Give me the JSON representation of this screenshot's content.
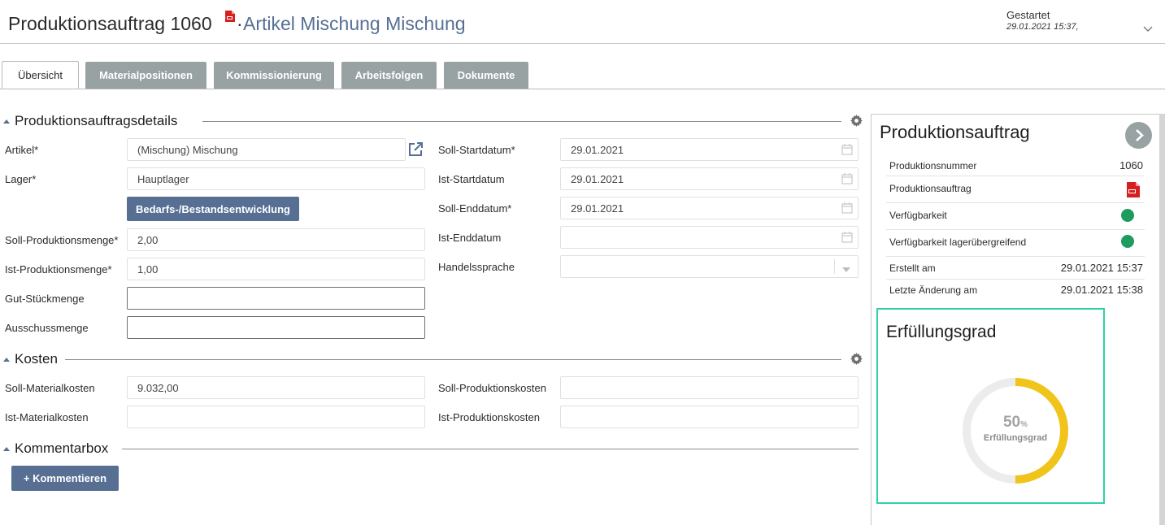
{
  "header": {
    "title": "Produktionsauftrag 1060",
    "separator": "·",
    "item_link": "Artikel Mischung Mischung",
    "status_label": "Gestartet",
    "status_date": "29.01.2021 15:37,"
  },
  "tabs": [
    "Übersicht",
    "Materialpositionen",
    "Kommissionierung",
    "Arbeitsfolgen",
    "Dokumente"
  ],
  "details": {
    "title": "Produktionsauftragsdetails",
    "artikel_label": "Artikel*",
    "artikel_value": "(Mischung) Mischung",
    "lager_label": "Lager*",
    "lager_value": "Hauptlager",
    "bedarf_button": "Bedarfs-/Bestandsentwicklung",
    "soll_menge_label": "Soll-Produktionsmenge*",
    "soll_menge_value": "2,00",
    "ist_menge_label": "Ist-Produktionsmenge*",
    "ist_menge_value": "1,00",
    "gut_label": "Gut-Stückmenge",
    "gut_value": "",
    "ausschuss_label": "Ausschussmenge",
    "ausschuss_value": "",
    "soll_start_label": "Soll-Startdatum*",
    "soll_start_value": "29.01.2021",
    "ist_start_label": "Ist-Startdatum",
    "ist_start_value": "29.01.2021",
    "soll_end_label": "Soll-Enddatum*",
    "soll_end_value": "29.01.2021",
    "ist_end_label": "Ist-Enddatum",
    "ist_end_value": "",
    "sprache_label": "Handelssprache",
    "sprache_value": ""
  },
  "kosten": {
    "title": "Kosten",
    "soll_mat_label": "Soll-Materialkosten",
    "soll_mat_value": "9.032,00",
    "ist_mat_label": "Ist-Materialkosten",
    "ist_mat_value": "",
    "soll_prod_label": "Soll-Produktionskosten",
    "soll_prod_value": "",
    "ist_prod_label": "Ist-Produktionskosten",
    "ist_prod_value": ""
  },
  "kommentar": {
    "title": "Kommentarbox",
    "button": "+ Kommentieren"
  },
  "panel": {
    "title": "Produktionsauftrag",
    "rows": [
      {
        "label": "Produktionsnummer",
        "value": "1060"
      },
      {
        "label": "Produktionsauftrag",
        "value": ""
      },
      {
        "label": "Verfügbarkeit",
        "value": ""
      },
      {
        "label": "Verfügbarkeit lagerübergreifend",
        "value": ""
      },
      {
        "label": "Erstellt am",
        "value": "29.01.2021 15:37"
      },
      {
        "label": "Letzte Änderung am",
        "value": "29.01.2021 15:38"
      }
    ]
  },
  "fulfillment": {
    "title": "Erfüllungsgrad",
    "percent": 50,
    "percent_text": "50",
    "percent_sign": "%",
    "caption": "Erfüllungsgrad"
  },
  "colors": {
    "accent_blue": "#566f93",
    "tab_gray": "#98a2a3",
    "status_green": "#1e9c5e",
    "gauge_yellow": "#f0c419",
    "card_border": "#2ed1a7"
  },
  "icons": [
    "pdf-icon",
    "chevron-down-icon",
    "external-link-icon",
    "gear-icon",
    "calendar-icon",
    "dropdown-arrow-icon",
    "arrow-right-icon"
  ]
}
